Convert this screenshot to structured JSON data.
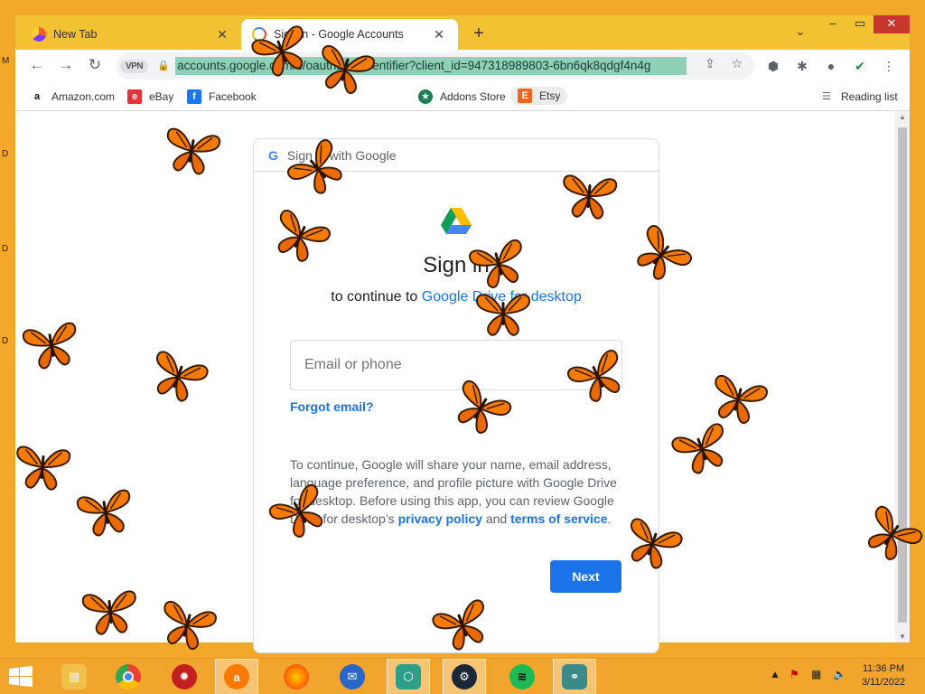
{
  "desktop": {
    "edge_glyphs": [
      "M",
      "D",
      "D",
      "D"
    ]
  },
  "window": {
    "tabs": [
      {
        "title": "New Tab",
        "active": false
      },
      {
        "title": "Sign in - Google Accounts",
        "active": true
      }
    ],
    "new_tab_symbol": "+",
    "tab_search_symbol": "⌄",
    "controls": {
      "minimize": "–",
      "maximize": "▭",
      "close": "✕"
    }
  },
  "toolbar": {
    "back": "←",
    "forward": "→",
    "reload": "↻",
    "vpn_label": "VPN",
    "url": "accounts.google.com/o/oauth2/v2/identifier?client_id=947318989803-6bn6qk8qdgf4n4g",
    "icons": [
      "share-icon",
      "star-icon",
      "adblock-icon",
      "extensions-icon",
      "profile-icon",
      "shield-icon",
      "menu-icon"
    ]
  },
  "bookmarks": {
    "items": [
      {
        "label": "Amazon.com",
        "icon": "amazon-icon",
        "color": "#111111",
        "glyph": "a"
      },
      {
        "label": "eBay",
        "icon": "ebay-icon",
        "color": "#e53238",
        "glyph": "e"
      },
      {
        "label": "Facebook",
        "icon": "facebook-icon",
        "color": "#1877f2",
        "glyph": "f"
      },
      {
        "label": "Addons Store",
        "icon": "addons-icon",
        "color": "#1a7f52",
        "glyph": "★"
      },
      {
        "label": "Etsy",
        "icon": "etsy-icon",
        "color": "#f1641e",
        "glyph": "E"
      }
    ],
    "reading_list": "Reading list"
  },
  "signin": {
    "header": "Sign in with Google",
    "google_glyph": "G",
    "heading": "Sign in",
    "subheading_prefix": "to continue to ",
    "app_name": "Google Drive for desktop",
    "email_placeholder": "Email or phone",
    "forgot_email": "Forgot email?",
    "notice_text": "To continue, Google will share your name, email address, language preference, and profile picture with Google Drive for desktop. Before using this app, you can review Google Drive for desktop’s ",
    "privacy_policy": "privacy policy",
    "and": " and ",
    "terms": "terms of service",
    "period": ".",
    "next_button": "Next"
  },
  "taskbar": {
    "apps": [
      {
        "name": "file-explorer-icon",
        "color": "#f0c04a"
      },
      {
        "name": "chrome-icon",
        "color": "#4285f4"
      },
      {
        "name": "app-red-icon",
        "color": "#c41f1f"
      },
      {
        "name": "avast-icon",
        "color": "#ff7800"
      },
      {
        "name": "firefox-icon",
        "color": "#ff6a00"
      },
      {
        "name": "thunderbird-icon",
        "color": "#2a65c8"
      },
      {
        "name": "secure-app-icon",
        "color": "#2c9e8a"
      },
      {
        "name": "steam-icon",
        "color": "#1b2838"
      },
      {
        "name": "spotify-icon",
        "color": "#1db954"
      },
      {
        "name": "network-app-icon",
        "color": "#3a8a8a"
      }
    ],
    "time": "11:36 PM",
    "date": "3/11/2022"
  },
  "colors": {
    "accent": "#1a73e8",
    "butterfly": "#f57c00"
  }
}
